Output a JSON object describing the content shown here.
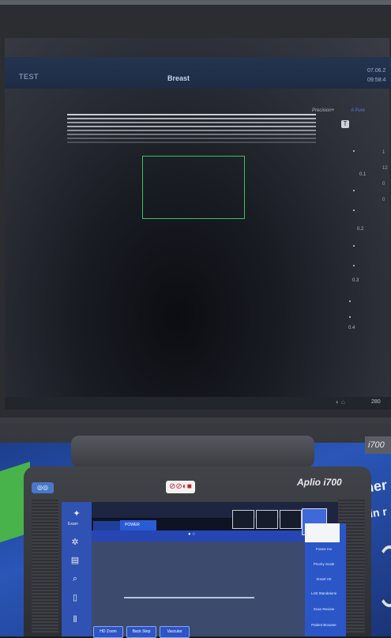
{
  "monitor": {
    "patient_id": "TEST",
    "exam_type": "Breast",
    "date": "07.06.2",
    "time": "09:58:4",
    "preset": "Precision+",
    "probe": "A Pure",
    "scale_labels": [
      "0.1",
      "0.2",
      "0.3",
      "0.4"
    ],
    "side_values": [
      "1",
      "12",
      "0",
      "0"
    ],
    "bottom_value": "280"
  },
  "signage": {
    "right_model": "i700",
    "wall_text_1": "ner",
    "wall_text_2": "in r"
  },
  "console": {
    "model": "Aplio i700"
  },
  "touch_panel": {
    "sidebar_label": "Exam",
    "active_tab": "POWER",
    "page_indicator": "● ○",
    "menu_items": [
      "Frame Inv",
      "Priority Scale",
      "Smart VE",
      "LAB Standalone",
      "Scan Review",
      "Patient Browser"
    ],
    "bottom_buttons": [
      "HD Zoom",
      "Back Step",
      "Vascular"
    ]
  },
  "colors": {
    "roi": "#39c35a",
    "panel_blue": "#2a56c8",
    "console_dark": "#2c2e33"
  }
}
